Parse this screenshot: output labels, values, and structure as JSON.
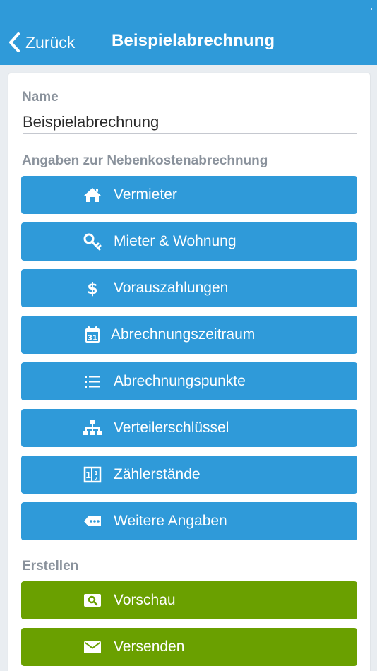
{
  "navbar": {
    "back_label": "Zurück",
    "title": "Beispielabrechnung",
    "color": "#2f9ad9"
  },
  "form": {
    "name_label": "Name",
    "name_value": "Beispielabrechnung",
    "details_section_label": "Angaben zur Nebenkostenabrechnung",
    "create_section_label": "Erstellen"
  },
  "details_buttons": [
    {
      "label": "Vermieter",
      "icon": "home-icon"
    },
    {
      "label": "Mieter & Wohnung",
      "icon": "key-icon"
    },
    {
      "label": "Vorauszahlungen",
      "icon": "dollar-icon"
    },
    {
      "label": "Abrechnungszeitraum",
      "icon": "calendar-icon"
    },
    {
      "label": "Abrechnungspunkte",
      "icon": "list-icon"
    },
    {
      "label": "Verteilerschlüssel",
      "icon": "sitemap-icon"
    },
    {
      "label": "Zählerstände",
      "icon": "meter-icon"
    },
    {
      "label": "Weitere Angaben",
      "icon": "tag-dots-icon"
    }
  ],
  "create_buttons": [
    {
      "label": "Vorschau",
      "icon": "preview-icon"
    },
    {
      "label": "Versenden",
      "icon": "envelope-icon"
    }
  ],
  "colors": {
    "primary_button": "#2f9ad9",
    "action_button": "#6aa000",
    "background": "#e9edf1"
  }
}
